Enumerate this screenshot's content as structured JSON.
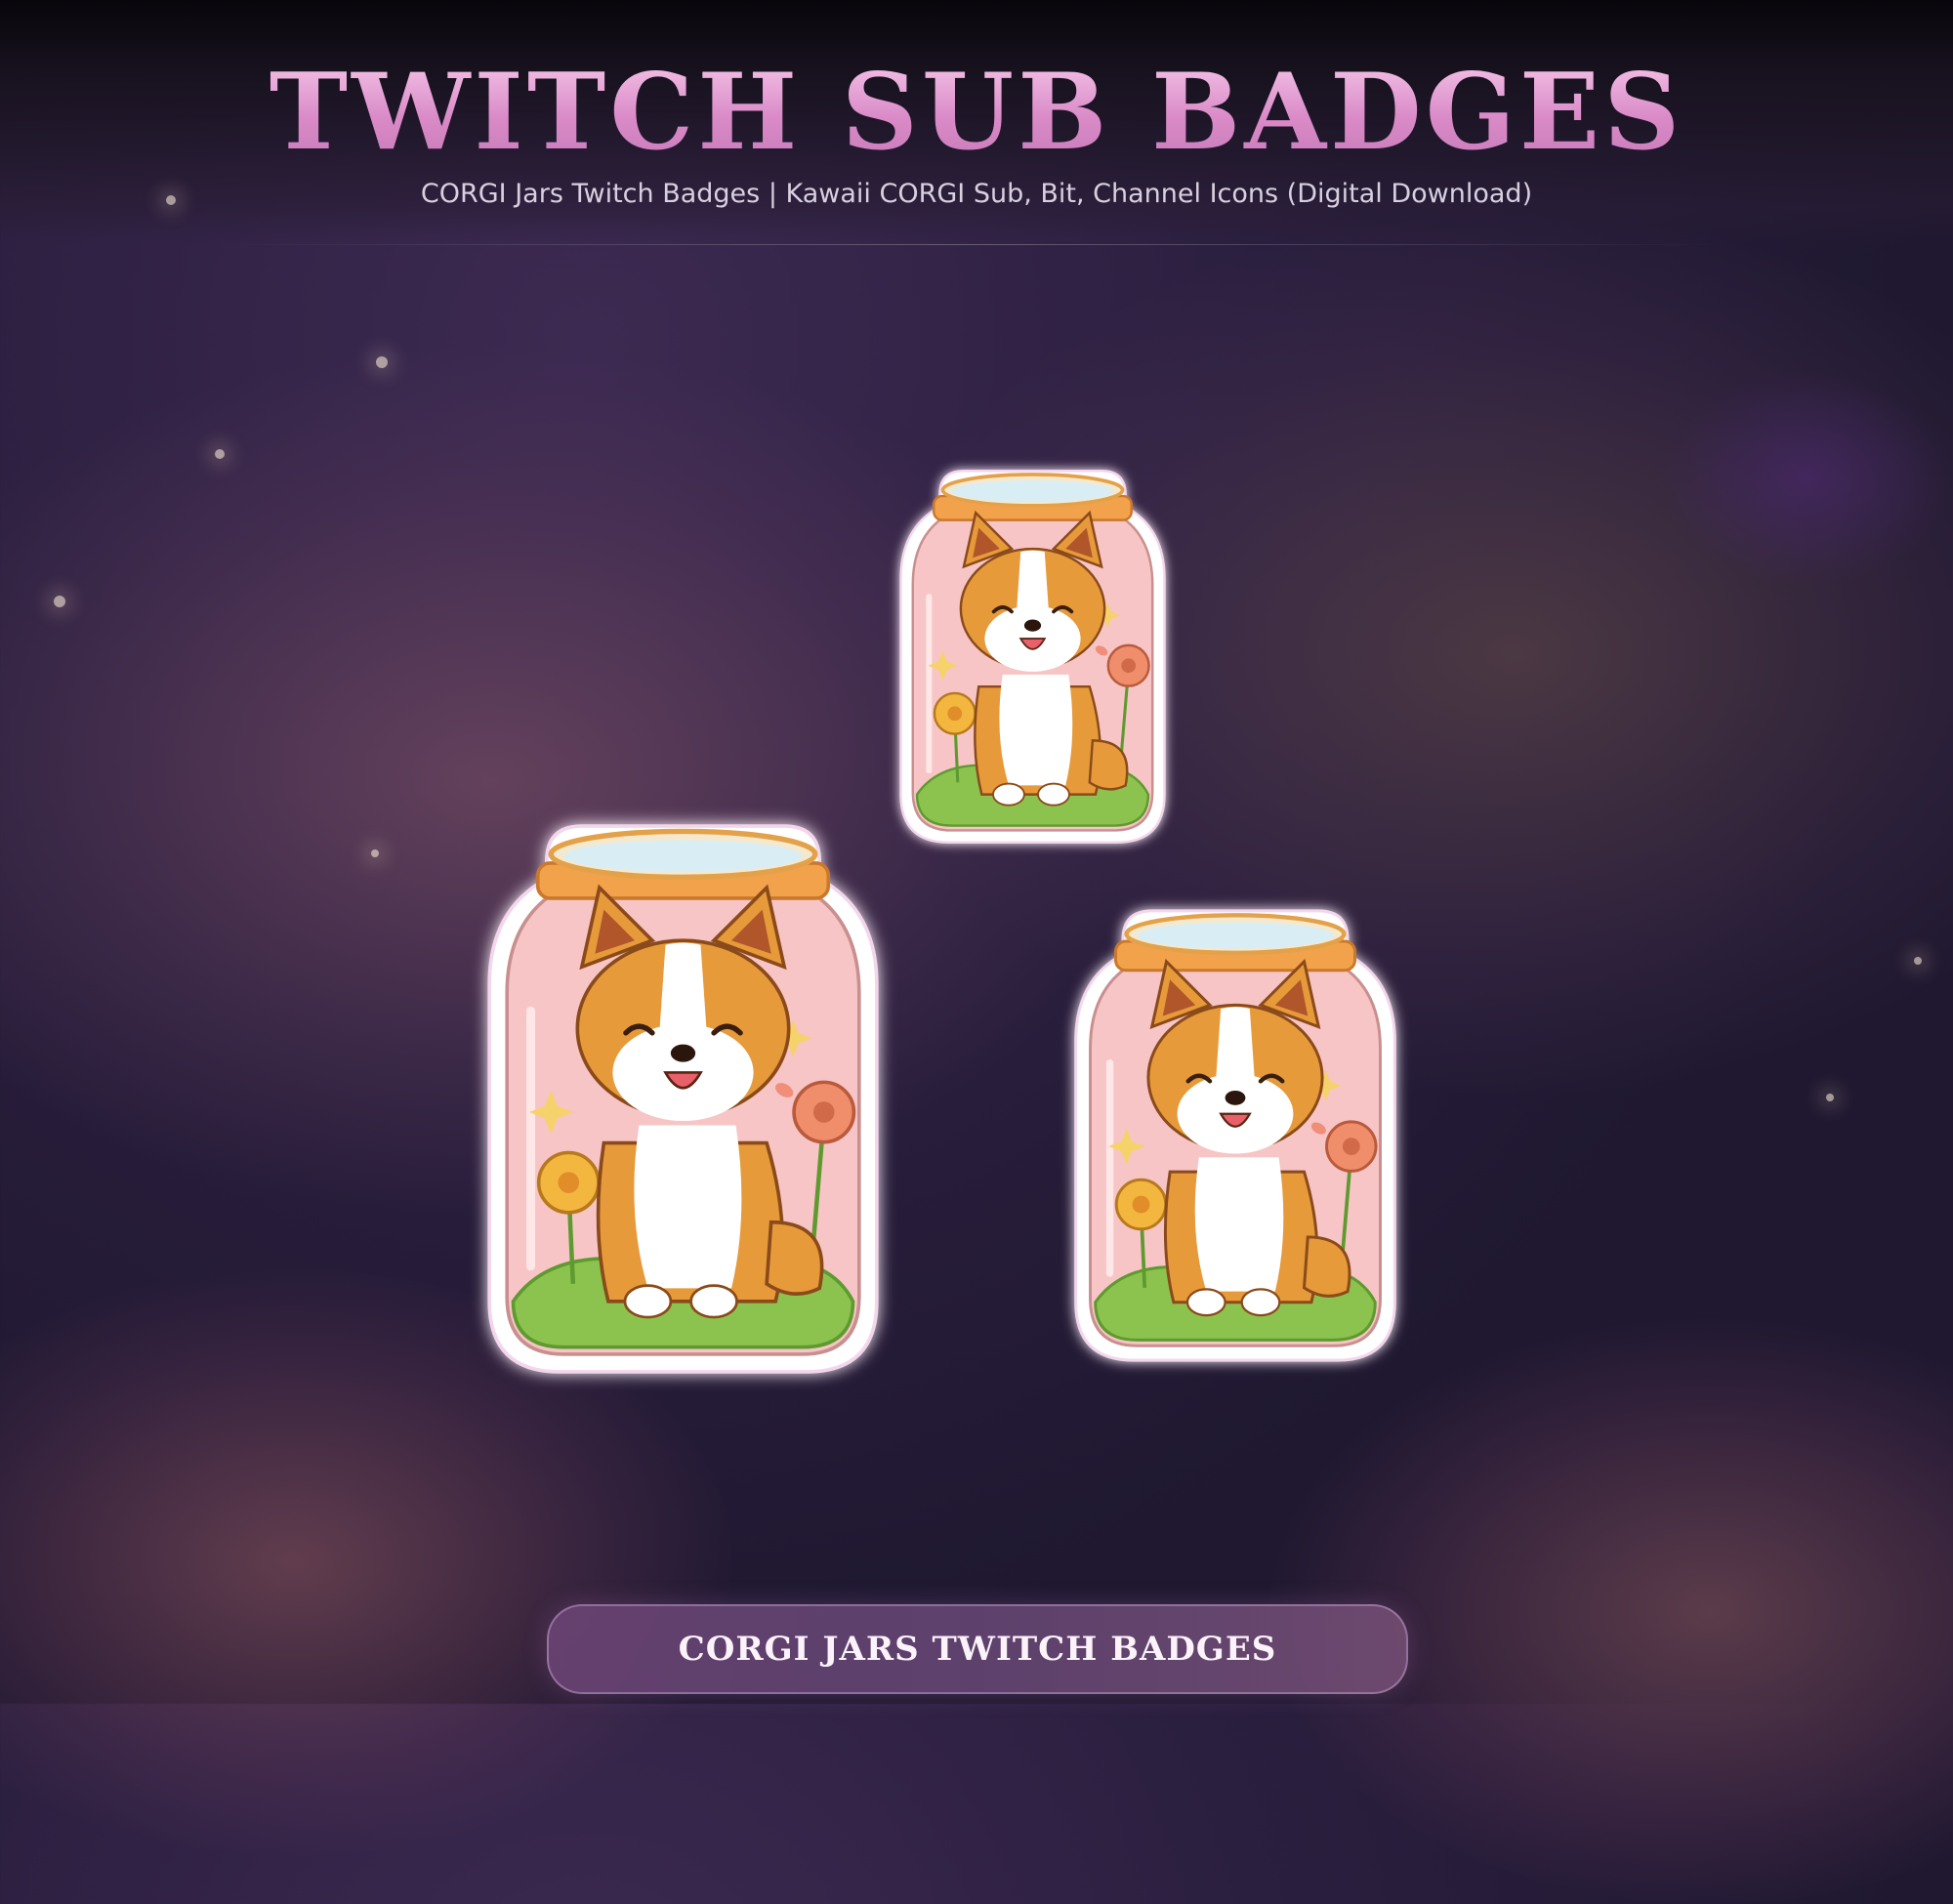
{
  "header": {
    "title": "TWITCH SUB BADGES",
    "subtitle": "CORGI Jars Twitch Badges | Kawaii CORGI Sub, Bit, Channel Icons (Digital Download)"
  },
  "badges": [
    {
      "name": "corgi-jar-badge-small",
      "icon": "corgi-in-jar"
    },
    {
      "name": "corgi-jar-badge-large",
      "icon": "corgi-in-jar"
    },
    {
      "name": "corgi-jar-badge-medium",
      "icon": "corgi-in-jar"
    }
  ],
  "footer": {
    "button_label": "CORGI JARS TWITCH BADGES"
  },
  "colors": {
    "title": "#e8a8d6",
    "jar_fill": "#f6c6c6",
    "lid": "#f0a84a",
    "corgi": "#e69a3a",
    "grass": "#8cc34e",
    "background": "#3b2a55"
  }
}
